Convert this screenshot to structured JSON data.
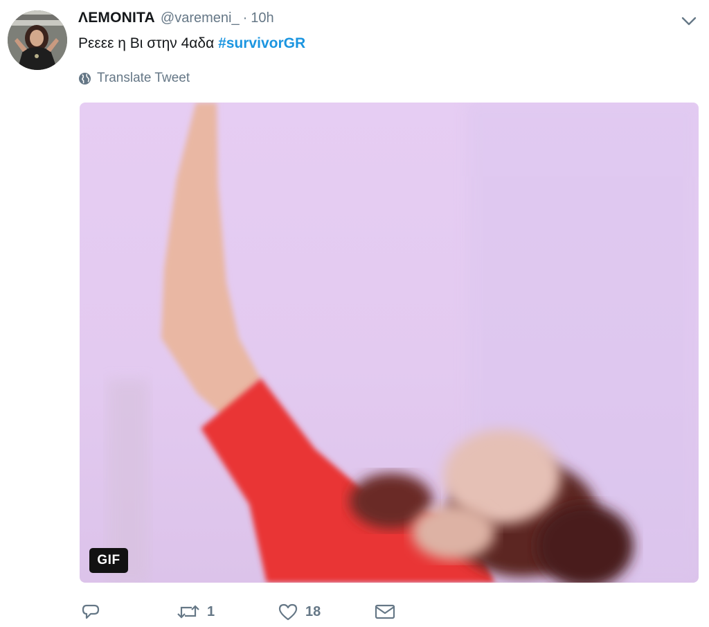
{
  "tweet": {
    "author": {
      "display_name": "ΛΕΜΟΝΙΤΑ",
      "handle": "@varemeni_",
      "avatar_icon": "profile-photo"
    },
    "separator": "·",
    "time": "10h",
    "text_prefix": "Ρεεεε η Βι στην 4αδα ",
    "hashtag": "#survivorGR",
    "translate_label": "Translate Tweet",
    "media": {
      "type": "gif",
      "badge": "GIF",
      "description_icon": "animated-gif"
    },
    "actions": {
      "reply_icon": "reply-icon",
      "retweet_count": "1",
      "like_count": "18",
      "dm_icon": "envelope-icon"
    }
  },
  "colors": {
    "link": "#1b95e0",
    "secondary_text": "#657786",
    "primary_text": "#14171a"
  }
}
